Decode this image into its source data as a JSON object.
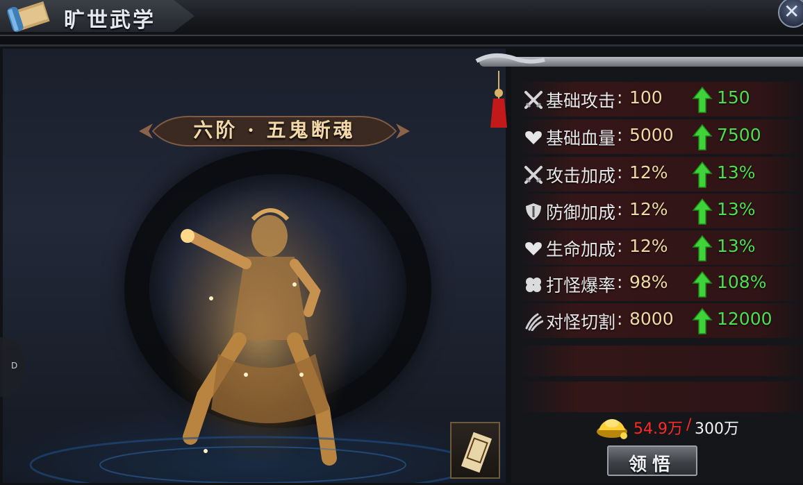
{
  "header": {
    "title": "旷世武学",
    "scroll_icon": "scroll-icon",
    "close_icon": "close-x-icon"
  },
  "skill": {
    "name": "六阶 · 五鬼断魂"
  },
  "side_tab": {
    "label": "D"
  },
  "stats": [
    {
      "icon": "crossed-swords-icon",
      "name": "基础攻击",
      "value": "100",
      "next": "150"
    },
    {
      "icon": "heart-icon",
      "name": "基础血量",
      "value": "5000",
      "next": "7500"
    },
    {
      "icon": "crossed-swords-icon",
      "name": "攻击加成",
      "value": "12%",
      "next": "13%"
    },
    {
      "icon": "shield-icon",
      "name": "防御加成",
      "value": "12%",
      "next": "13%"
    },
    {
      "icon": "heart-icon",
      "name": "生命加成",
      "value": "12%",
      "next": "13%"
    },
    {
      "icon": "clover-icon",
      "name": "打怪爆率",
      "value": "98%",
      "next": "108%"
    },
    {
      "icon": "claw-icon",
      "name": "对怪切割",
      "value": "8000",
      "next": "12000"
    }
  ],
  "stat_colon": ":",
  "cost": {
    "icon": "gold-ingot-icon",
    "have": "54.9万",
    "slash": "/",
    "need": "300万"
  },
  "learn_button": {
    "label": "领悟"
  },
  "colors": {
    "stat_value": "#f1d9a1",
    "stat_next": "#4de04a",
    "cost_have": "#ff2a24",
    "skill_name": "#f3d8a8"
  }
}
